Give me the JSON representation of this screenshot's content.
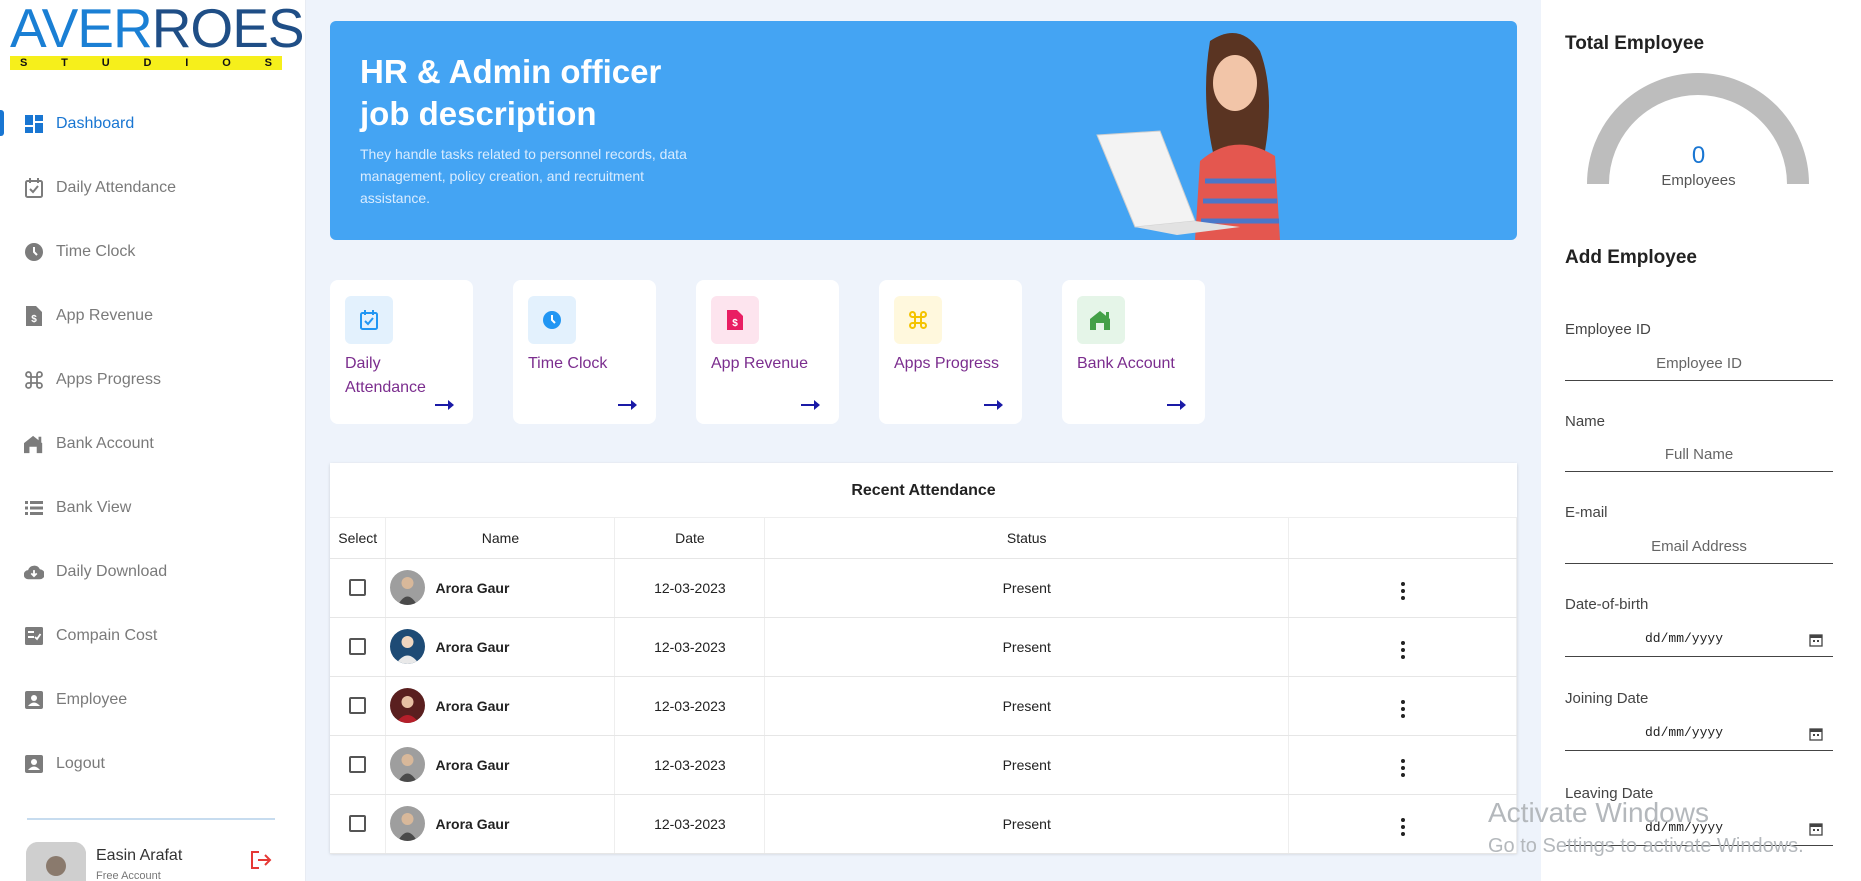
{
  "brand": {
    "name_part1": "AVER",
    "name_part2": "ROES",
    "tagline": "STUDIOS"
  },
  "sidebar": {
    "items": [
      {
        "label": "Dashboard",
        "icon": "dashboard-icon",
        "active": true
      },
      {
        "label": "Daily Attendance",
        "icon": "calendar-check-icon"
      },
      {
        "label": "Time Clock",
        "icon": "clock-icon"
      },
      {
        "label": "App Revenue",
        "icon": "revenue-doc-icon"
      },
      {
        "label": "Apps Progress",
        "icon": "command-icon"
      },
      {
        "label": "Bank Account",
        "icon": "bank-icon"
      },
      {
        "label": "Bank View",
        "icon": "list-icon"
      },
      {
        "label": "Daily Download",
        "icon": "cloud-download-icon"
      },
      {
        "label": "Compain Cost",
        "icon": "checklist-icon"
      },
      {
        "label": "Employee",
        "icon": "person-box-icon"
      },
      {
        "label": "Logout",
        "icon": "person-box-icon"
      }
    ],
    "profile": {
      "name": "Easin Arafat",
      "subtitle": "Free Account"
    }
  },
  "banner": {
    "title": "HR & Admin officer job description",
    "text": "They handle tasks related to personnel records, data management, policy creation, and recruitment assistance."
  },
  "cards": [
    {
      "label": "Daily Attendance",
      "icon": "calendar-check-icon",
      "bg": "#e3f1fd",
      "color": "#2196f3"
    },
    {
      "label": "Time Clock",
      "icon": "clock-icon",
      "bg": "#e3f1fd",
      "color": "#2196f3"
    },
    {
      "label": "App Revenue",
      "icon": "revenue-doc-icon",
      "bg": "#fde4ee",
      "color": "#e91e63"
    },
    {
      "label": "Apps Progress",
      "icon": "command-icon",
      "bg": "#fff8dd",
      "color": "#f4c300"
    },
    {
      "label": "Bank Account",
      "icon": "bank-icon",
      "bg": "#e5f5e8",
      "color": "#43a047"
    }
  ],
  "attendance": {
    "title": "Recent Attendance",
    "columns": [
      "Select",
      "Name",
      "Date",
      "Status",
      ""
    ],
    "rows": [
      {
        "name": "Arora Gaur",
        "date": "12-03-2023",
        "status": "Present"
      },
      {
        "name": "Arora Gaur",
        "date": "12-03-2023",
        "status": "Present"
      },
      {
        "name": "Arora Gaur",
        "date": "12-03-2023",
        "status": "Present"
      },
      {
        "name": "Arora Gaur",
        "date": "12-03-2023",
        "status": "Present"
      },
      {
        "name": "Arora Gaur",
        "date": "12-03-2023",
        "status": "Present"
      }
    ]
  },
  "total_employee": {
    "title": "Total Employee",
    "value": "0",
    "label": "Employees"
  },
  "add_employee": {
    "title": "Add Employee",
    "fields": [
      {
        "label": "Employee ID",
        "placeholder": "Employee ID"
      },
      {
        "label": "Name",
        "placeholder": "Full Name"
      },
      {
        "label": "E-mail",
        "placeholder": "Email Address"
      }
    ],
    "date_fields": [
      {
        "label": "Date-of-birth",
        "value": "dd/mm/yyyy"
      },
      {
        "label": "Joining Date",
        "value": "dd/mm/yyyy"
      },
      {
        "label": "Leaving Date",
        "value": "dd/mm/yyyy"
      }
    ]
  },
  "watermark": {
    "line1": "Activate Windows",
    "line2": "Go to Settings to activate Windows."
  },
  "colors": {
    "primary": "#1976d2",
    "banner": "#44a4f3",
    "card_label": "#7b2d8e",
    "logout": "#e53935"
  }
}
